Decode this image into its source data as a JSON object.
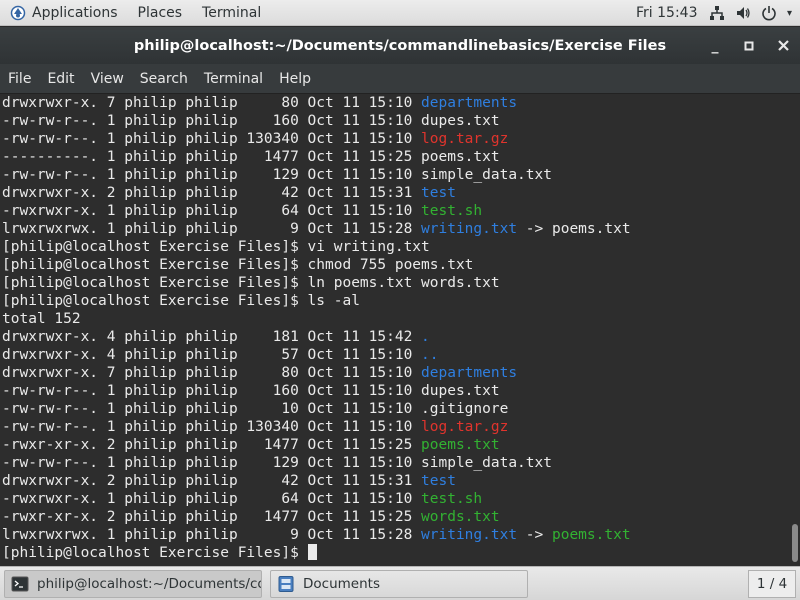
{
  "topbar": {
    "applications": "Applications",
    "places": "Places",
    "terminal": "Terminal",
    "clock": "Fri 15:43",
    "icons": [
      "network-icon",
      "volume-icon",
      "power-icon"
    ]
  },
  "window": {
    "title": "philip@localhost:~/Documents/commandlinebasics/Exercise Files",
    "controls": {
      "minimize": "_",
      "maximize": "□",
      "close": "×"
    }
  },
  "menu": [
    "File",
    "Edit",
    "View",
    "Search",
    "Terminal",
    "Help"
  ],
  "terminal": {
    "colors": {
      "dir": "#2f7fe0",
      "archive": "#e0342d",
      "exec": "#32b232",
      "text": "#eaeaea",
      "bg": "#2d2d2d"
    },
    "lines": [
      {
        "prefix": "drwxrwxr-x. 7 philip philip     80 Oct 11 15:10 ",
        "name": "departments",
        "type": "dir"
      },
      {
        "prefix": "-rw-rw-r--. 1 philip philip    160 Oct 11 15:10 ",
        "name": "dupes.txt",
        "type": "plain"
      },
      {
        "prefix": "-rw-rw-r--. 1 philip philip 130340 Oct 11 15:10 ",
        "name": "log.tar.gz",
        "type": "archive"
      },
      {
        "prefix": "----------. 1 philip philip   1477 Oct 11 15:25 ",
        "name": "poems.txt",
        "type": "plain"
      },
      {
        "prefix": "-rw-rw-r--. 1 philip philip    129 Oct 11 15:10 ",
        "name": "simple_data.txt",
        "type": "plain"
      },
      {
        "prefix": "drwxrwxr-x. 2 philip philip     42 Oct 11 15:31 ",
        "name": "test",
        "type": "dir"
      },
      {
        "prefix": "-rwxrwxr-x. 1 philip philip     64 Oct 11 15:10 ",
        "name": "test.sh",
        "type": "exec"
      },
      {
        "prefix": "lrwxrwxrwx. 1 philip philip      9 Oct 11 15:28 ",
        "name": "writing.txt",
        "type": "dir",
        "arrow": " -> ",
        "target": "poems.txt",
        "target_type": "plain"
      },
      {
        "prefix": "[philip@localhost Exercise Files]$ vi writing.txt",
        "name": "",
        "type": "plain"
      },
      {
        "prefix": "[philip@localhost Exercise Files]$ chmod 755 poems.txt",
        "name": "",
        "type": "plain"
      },
      {
        "prefix": "[philip@localhost Exercise Files]$ ln poems.txt words.txt",
        "name": "",
        "type": "plain"
      },
      {
        "prefix": "[philip@localhost Exercise Files]$ ls -al",
        "name": "",
        "type": "plain"
      },
      {
        "prefix": "total 152",
        "name": "",
        "type": "plain"
      },
      {
        "prefix": "drwxrwxr-x. 4 philip philip    181 Oct 11 15:42 ",
        "name": ".",
        "type": "dir"
      },
      {
        "prefix": "drwxrwxr-x. 4 philip philip     57 Oct 11 15:10 ",
        "name": "..",
        "type": "dir"
      },
      {
        "prefix": "drwxrwxr-x. 7 philip philip     80 Oct 11 15:10 ",
        "name": "departments",
        "type": "dir"
      },
      {
        "prefix": "-rw-rw-r--. 1 philip philip    160 Oct 11 15:10 ",
        "name": "dupes.txt",
        "type": "plain"
      },
      {
        "prefix": "-rw-rw-r--. 1 philip philip     10 Oct 11 15:10 ",
        "name": ".gitignore",
        "type": "plain"
      },
      {
        "prefix": "-rw-rw-r--. 1 philip philip 130340 Oct 11 15:10 ",
        "name": "log.tar.gz",
        "type": "archive"
      },
      {
        "prefix": "-rwxr-xr-x. 2 philip philip   1477 Oct 11 15:25 ",
        "name": "poems.txt",
        "type": "exec"
      },
      {
        "prefix": "-rw-rw-r--. 1 philip philip    129 Oct 11 15:10 ",
        "name": "simple_data.txt",
        "type": "plain"
      },
      {
        "prefix": "drwxrwxr-x. 2 philip philip     42 Oct 11 15:31 ",
        "name": "test",
        "type": "dir"
      },
      {
        "prefix": "-rwxrwxr-x. 1 philip philip     64 Oct 11 15:10 ",
        "name": "test.sh",
        "type": "exec"
      },
      {
        "prefix": "-rwxr-xr-x. 2 philip philip   1477 Oct 11 15:25 ",
        "name": "words.txt",
        "type": "exec"
      },
      {
        "prefix": "lrwxrwxrwx. 1 philip philip      9 Oct 11 15:28 ",
        "name": "writing.txt",
        "type": "dir",
        "arrow": " -> ",
        "target": "poems.txt",
        "target_type": "exec"
      }
    ],
    "prompt": "[philip@localhost Exercise Files]$ "
  },
  "taskbar": {
    "tasks": [
      {
        "label": "philip@localhost:~/Documents/com…",
        "icon": "terminal-icon",
        "active": true
      },
      {
        "label": "Documents",
        "icon": "file-manager-icon",
        "active": false
      }
    ],
    "pager": "1 / 4"
  }
}
